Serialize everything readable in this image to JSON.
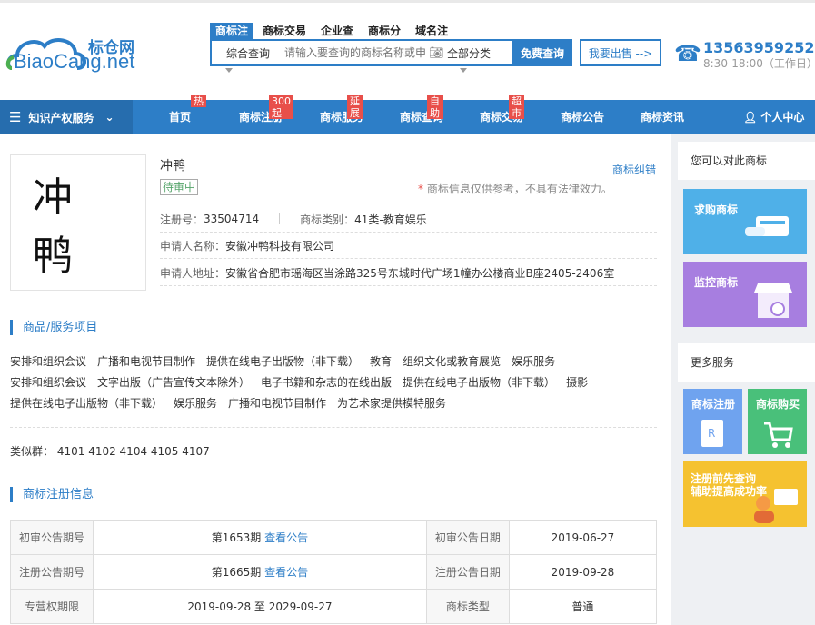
{
  "header": {
    "logo_cn": "标仓网",
    "logo_en": "BiaoCang.net",
    "search_tabs": [
      "商标注",
      "商标交易",
      "企业查",
      "商标分",
      "域名注"
    ],
    "search_type": "综合查询",
    "search_placeholder": "请输入要查询的商标名称或申",
    "category": "全部分类",
    "search_button": "免费查询",
    "sell_button": "我要出售 -->",
    "phone": "13563959252",
    "hours": "8:30-18:00（工作日）"
  },
  "nav": {
    "ipm": "知识产权服务",
    "items": [
      {
        "label": "首页",
        "badge": "热"
      },
      {
        "label": "商标注册",
        "badge": "300起"
      },
      {
        "label": "商标服务",
        "badge": "延展"
      },
      {
        "label": "商标查询",
        "badge": "自助"
      },
      {
        "label": "商标交易",
        "badge": "超市"
      },
      {
        "label": "商标公告",
        "badge": ""
      },
      {
        "label": "商标资讯",
        "badge": ""
      }
    ],
    "user": "个人中心"
  },
  "trademark": {
    "image_text": "冲鸭",
    "name": "冲鸭",
    "status": "待审中",
    "correction_link": "商标纠错",
    "note_star": "*",
    "note": "商标信息仅供参考，不具有法律效力。",
    "reg_no_label": "注册号：",
    "reg_no": "33504714",
    "class_label": "商标类别：",
    "class": "41类-教育娱乐",
    "applicant_label": "申请人名称：",
    "applicant": "安徽冲鸭科技有限公司",
    "address_label": "申请人地址：",
    "address": "安徽省合肥市瑶海区当涂路325号东城时代广场1幢办公楼商业B座2405-2406室"
  },
  "goods": {
    "title": "商品/服务项目",
    "rows": [
      [
        "安排和组织会议",
        "广播和电视节目制作",
        "提供在线电子出版物（非下载）",
        "教育",
        "组织文化或教育展览",
        "娱乐服务"
      ],
      [
        "安排和组织会议",
        "文字出版（广告宣传文本除外）",
        "电子书籍和杂志的在线出版",
        "提供在线电子出版物（非下载）",
        "摄影"
      ],
      [
        "提供在线电子出版物（非下载）",
        "娱乐服务",
        "广播和电视节目制作",
        "为艺术家提供模特服务"
      ]
    ],
    "similar_label": "类似群：",
    "similar": "4101 4102 4104 4105 4107"
  },
  "registration": {
    "title": "商标注册信息",
    "rows": [
      {
        "k1": "初审公告期号",
        "v1": "第1653期",
        "link1": "查看公告",
        "k2": "初审公告日期",
        "v2": "2019-06-27"
      },
      {
        "k1": "注册公告期号",
        "v1": "第1665期",
        "link1": "查看公告",
        "k2": "注册公告日期",
        "v2": "2019-09-28"
      },
      {
        "k1": "专营权期限",
        "v1": "2019-09-28 至 2029-09-27",
        "link1": "",
        "k2": "商标类型",
        "v2": "普通"
      }
    ]
  },
  "sidebar": {
    "compare_title": "您可以对此商标",
    "buy": "求购商标",
    "monitor": "监控商标",
    "more_title": "更多服务",
    "register": "商标注册",
    "purchase": "商标购买",
    "promo_line1": "注册前先查询",
    "promo_line2": "辅助提高成功率",
    "colors": {
      "buy": "#4fb0e8",
      "monitor": "#a77ee0",
      "register": "#6fa3ef",
      "purchase": "#49c07a",
      "promo": "#f5c230"
    }
  }
}
